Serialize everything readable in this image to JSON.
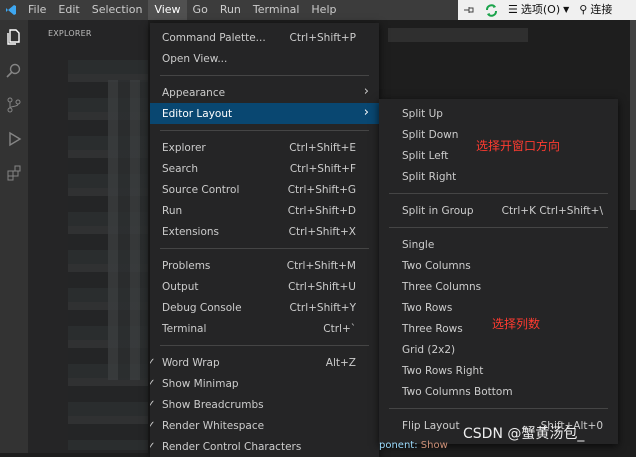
{
  "menubar": {
    "items": [
      "File",
      "Edit",
      "Selection",
      "View",
      "Go",
      "Run",
      "Terminal",
      "Help"
    ],
    "active": "View"
  },
  "toolbar": {
    "options_label": "选项(O)",
    "connect_label": "连接"
  },
  "sidebar": {
    "title": "EXPLORER"
  },
  "view_menu": {
    "groups": [
      [
        {
          "label": "Command Palette...",
          "shortcut": "Ctrl+Shift+P"
        },
        {
          "label": "Open View...",
          "shortcut": ""
        }
      ],
      [
        {
          "label": "Appearance",
          "shortcut": "",
          "submenu": true
        },
        {
          "label": "Editor Layout",
          "shortcut": "",
          "submenu": true,
          "selected": true
        }
      ],
      [
        {
          "label": "Explorer",
          "shortcut": "Ctrl+Shift+E"
        },
        {
          "label": "Search",
          "shortcut": "Ctrl+Shift+F"
        },
        {
          "label": "Source Control",
          "shortcut": "Ctrl+Shift+G"
        },
        {
          "label": "Run",
          "shortcut": "Ctrl+Shift+D"
        },
        {
          "label": "Extensions",
          "shortcut": "Ctrl+Shift+X"
        }
      ],
      [
        {
          "label": "Problems",
          "shortcut": "Ctrl+Shift+M"
        },
        {
          "label": "Output",
          "shortcut": "Ctrl+Shift+U"
        },
        {
          "label": "Debug Console",
          "shortcut": "Ctrl+Shift+Y"
        },
        {
          "label": "Terminal",
          "shortcut": "Ctrl+`"
        }
      ],
      [
        {
          "label": "Word Wrap",
          "shortcut": "Alt+Z",
          "checked": true
        },
        {
          "label": "Show Minimap",
          "shortcut": "",
          "checked": true
        },
        {
          "label": "Show Breadcrumbs",
          "shortcut": "",
          "checked": true
        },
        {
          "label": "Render Whitespace",
          "shortcut": "",
          "checked": true
        },
        {
          "label": "Render Control Characters",
          "shortcut": "",
          "checked": true
        }
      ]
    ]
  },
  "layout_menu": {
    "groups": [
      [
        {
          "label": "Split Up",
          "shortcut": ""
        },
        {
          "label": "Split Down",
          "shortcut": ""
        },
        {
          "label": "Split Left",
          "shortcut": ""
        },
        {
          "label": "Split Right",
          "shortcut": ""
        }
      ],
      [
        {
          "label": "Split in Group",
          "shortcut": "Ctrl+K Ctrl+Shift+\\"
        }
      ],
      [
        {
          "label": "Single",
          "shortcut": ""
        },
        {
          "label": "Two Columns",
          "shortcut": ""
        },
        {
          "label": "Three Columns",
          "shortcut": ""
        },
        {
          "label": "Two Rows",
          "shortcut": ""
        },
        {
          "label": "Three Rows",
          "shortcut": ""
        },
        {
          "label": "Grid (2x2)",
          "shortcut": ""
        },
        {
          "label": "Two Rows Right",
          "shortcut": ""
        },
        {
          "label": "Two Columns Bottom",
          "shortcut": ""
        }
      ],
      [
        {
          "label": "Flip Layout",
          "shortcut": "Shift+Alt+0"
        }
      ]
    ]
  },
  "annotations": {
    "split_direction": "选择开窗口方向",
    "columns": "选择列数"
  },
  "watermark": "CSDN @蟹黄汤包_",
  "code_hint": {
    "key": "ponent:",
    "value": "Show"
  },
  "colors": {
    "selection": "#094771",
    "annotation": "#ff3b30",
    "menubar": "#3c3c3c"
  }
}
